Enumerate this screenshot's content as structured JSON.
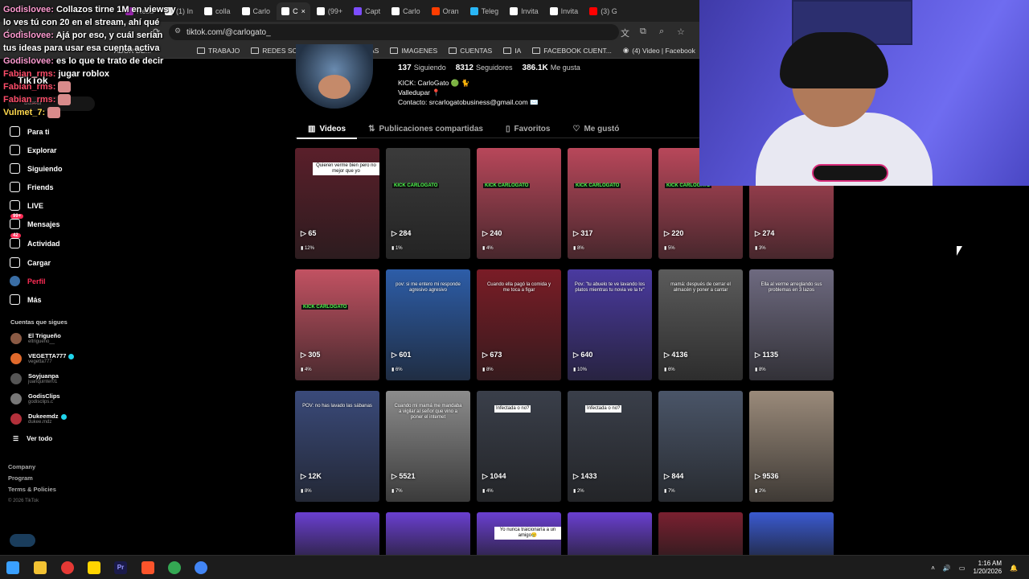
{
  "browser": {
    "tabs": [
      {
        "label": "Resu",
        "color": "#9c27b0"
      },
      {
        "label": "(1) In",
        "color": "#ffffff"
      },
      {
        "label": "colla",
        "color": "#ffffff"
      },
      {
        "label": "Carlo",
        "color": "#ffffff"
      },
      {
        "label": "C",
        "color": "#ffffff",
        "active": true
      },
      {
        "label": "(99+",
        "color": "#ffffff"
      },
      {
        "label": "Capt",
        "color": "#7c4dff"
      },
      {
        "label": "Carlo",
        "color": "#ffffff"
      },
      {
        "label": "Oran",
        "color": "#ff3d00"
      },
      {
        "label": "Teleg",
        "color": "#29b6f6"
      },
      {
        "label": "Invita",
        "color": "#ffffff"
      },
      {
        "label": "Invita",
        "color": "#ffffff"
      },
      {
        "label": "(3) G",
        "color": "#ff0000"
      }
    ],
    "url": "tiktok.com/@carlogato_",
    "bookmarks": [
      "TRABAJO",
      "REDES SOCIALES",
      "COMPRAS",
      "IMAGENES",
      "CUENTAS",
      "IA",
      "FACEBOOK CUENT...",
      "(4) Video | Facebook"
    ],
    "bookmark_partial": "ADOR DE..."
  },
  "chat": [
    {
      "user": "Godislovee:",
      "text": "Collazos tirne 1M en views y lo ves tú con 20 en el stream, ahí qué",
      "color": "pink"
    },
    {
      "user": "Godislovee:",
      "text": "Ajá por eso, y cuál serían tus ideas para usar esa cuenta activa",
      "color": "pink"
    },
    {
      "user": "Godislovee:",
      "text": "es lo que te trato de decir",
      "color": "pink"
    },
    {
      "user": "Fabian_rms:",
      "text": "jugar roblox",
      "color": "red"
    },
    {
      "user": "Fabian_rms:",
      "text": "",
      "color": "red"
    },
    {
      "user": "Fabian_rms:",
      "text": "",
      "color": "red"
    },
    {
      "user": "Vulmet_7:",
      "text": "",
      "color": "yel"
    }
  ],
  "sidebar": {
    "logo": "TikTok",
    "search_placeholder": "Buscar",
    "items": [
      {
        "label": "Para ti",
        "icon": "home-icon"
      },
      {
        "label": "Explorar",
        "icon": "compass-icon"
      },
      {
        "label": "Siguiendo",
        "icon": "following-icon"
      },
      {
        "label": "Friends",
        "icon": "friends-icon"
      },
      {
        "label": "LIVE",
        "icon": "live-icon"
      },
      {
        "label": "Mensajes",
        "icon": "messages-icon",
        "badge": "99+"
      },
      {
        "label": "Actividad",
        "icon": "activity-icon",
        "badge": "42"
      },
      {
        "label": "Cargar",
        "icon": "upload-icon"
      },
      {
        "label": "Perfil",
        "icon": "profile-icon"
      },
      {
        "label": "Más",
        "icon": "more-icon"
      }
    ],
    "following_title": "Cuentas que sigues",
    "following": [
      {
        "name": "El Trigueño",
        "handle": "eltrigueno__",
        "color": "#8a5a44",
        "verified": false
      },
      {
        "name": "VEGETTA777",
        "handle": "vegetta777",
        "color": "#e0692b",
        "verified": true
      },
      {
        "name": "Soyjuanpa",
        "handle": "juanquinter01",
        "color": "#555555",
        "verified": false
      },
      {
        "name": "GodisClips",
        "handle": "godisclips.c",
        "color": "#777777",
        "verified": false
      },
      {
        "name": "Dukeemdz",
        "handle": "dukee.mdz",
        "color": "#b3303a",
        "verified": true
      }
    ],
    "see_all": "Ver todo",
    "footer": [
      "Company",
      "Program",
      "Terms & Policies"
    ],
    "copyright": "© 2026 TikTok"
  },
  "profile": {
    "following_count": "137",
    "following_label": "Siguiendo",
    "followers_count": "8312",
    "followers_label": "Seguidores",
    "likes_count": "386.1K",
    "likes_label": "Me gusta",
    "bio_lines": [
      "KICK: CarloGato 🟢 🐈",
      "Valledupar 📍",
      "Contacto: srcarlogatobusiness@gmail.com ✉️"
    ],
    "tabs": [
      "Videos",
      "Publicaciones compartidas",
      "Favoritos",
      "Me gustó"
    ]
  },
  "videos": [
    {
      "views": "65",
      "pct": "12%",
      "bg": "#5a1f2a",
      "caption": "Quieren verme bien pero no mejor que yo",
      "capstyle": "box"
    },
    {
      "views": "284",
      "pct": "1%",
      "bg": "#3b3b3b",
      "caption": "",
      "capstyle": "kick"
    },
    {
      "views": "240",
      "pct": "4%",
      "bg": "#b8475a",
      "caption": "",
      "capstyle": "kick"
    },
    {
      "views": "317",
      "pct": "8%",
      "bg": "#b8475a",
      "caption": "",
      "capstyle": "kick"
    },
    {
      "views": "220",
      "pct": "5%",
      "bg": "#b8475a",
      "caption": "",
      "capstyle": "kick"
    },
    {
      "views": "274",
      "pct": "3%",
      "bg": "#b8475a",
      "caption": "",
      "capstyle": "none"
    },
    {
      "views": "305",
      "pct": "4%",
      "bg": "#c25262",
      "caption": "",
      "capstyle": "kick"
    },
    {
      "views": "601",
      "pct": "6%",
      "bg": "#2d5da8",
      "caption": "pov: si me entero mi responde agresivo agresivo",
      "capstyle": "text"
    },
    {
      "views": "673",
      "pct": "8%",
      "bg": "#7a1c26",
      "caption": "Cuando ella pagó la comida y me toca a figar",
      "capstyle": "text"
    },
    {
      "views": "640",
      "pct": "10%",
      "bg": "#4a3aa0",
      "caption": "Pov: \"tu abuelo te ve lavando los platos mientras tu novia ve la tv\"",
      "capstyle": "text"
    },
    {
      "views": "4136",
      "pct": "6%",
      "bg": "#5b5b5b",
      "caption": "mamá: después de cerrar el almacén y poner a cantar",
      "capstyle": "text"
    },
    {
      "views": "1135",
      "pct": "8%",
      "bg": "#6e6a80",
      "caption": "Ella al verme arreglando sus problemas en 3 lazos",
      "capstyle": "text"
    },
    {
      "views": "12K",
      "pct": "8%",
      "bg": "#3a4a7a",
      "caption": "POV: no has lavado las sábanas",
      "capstyle": "text"
    },
    {
      "views": "5521",
      "pct": "7%",
      "bg": "#8c8c8c",
      "caption": "Cuando mi mamá me mandaba a vigilar al señor que vino a poner el internet",
      "capstyle": "text"
    },
    {
      "views": "1044",
      "pct": "4%",
      "bg": "#3a3f4a",
      "caption": "Infectada o no?",
      "capstyle": "box"
    },
    {
      "views": "1433",
      "pct": "2%",
      "bg": "#3a3f4a",
      "caption": "Infectada o no?",
      "capstyle": "box"
    },
    {
      "views": "844",
      "pct": "7%",
      "bg": "#4a5568",
      "caption": "",
      "capstyle": "none"
    },
    {
      "views": "9536",
      "pct": "2%",
      "bg": "#9a8a7a",
      "caption": "",
      "capstyle": "none"
    },
    {
      "views": "",
      "pct": "",
      "bg": "#6a3fd0",
      "caption": "",
      "capstyle": "none"
    },
    {
      "views": "",
      "pct": "",
      "bg": "#6a3fd0",
      "caption": "",
      "capstyle": "none"
    },
    {
      "views": "",
      "pct": "",
      "bg": "#6a3fd0",
      "caption": "Yo nunca traicionaría a un amigo😢",
      "capstyle": "box"
    },
    {
      "views": "",
      "pct": "",
      "bg": "#6a3fd0",
      "caption": "",
      "capstyle": "none"
    },
    {
      "views": "",
      "pct": "",
      "bg": "#7a2030",
      "caption": "",
      "capstyle": "none"
    },
    {
      "views": "",
      "pct": "",
      "bg": "#3a5ad0",
      "caption": "",
      "capstyle": "none"
    }
  ],
  "taskbar": {
    "time": "1:16 AM",
    "date": "1/20/2026"
  }
}
